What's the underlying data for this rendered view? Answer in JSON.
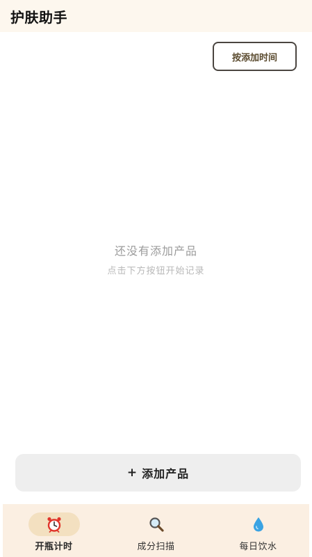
{
  "header": {
    "title": "护肤助手"
  },
  "toolbar": {
    "sort_label": "按添加时间"
  },
  "empty_state": {
    "title": "还没有添加产品",
    "subtitle": "点击下方按钮开始记录"
  },
  "add_button": {
    "plus": "+",
    "label": "添加产品"
  },
  "bottom_nav": {
    "active_index": 0,
    "items": [
      {
        "label": "开瓶计时",
        "icon": "alarm-clock-icon"
      },
      {
        "label": "成分扫描",
        "icon": "magnifier-icon"
      },
      {
        "label": "每日饮水",
        "icon": "water-drop-icon"
      }
    ]
  },
  "colors": {
    "header_bg": "#fdf7ee",
    "nav_bg": "#fbefe2",
    "active_pill": "#f3e0c0",
    "accent_text": "#5a4a2e"
  }
}
